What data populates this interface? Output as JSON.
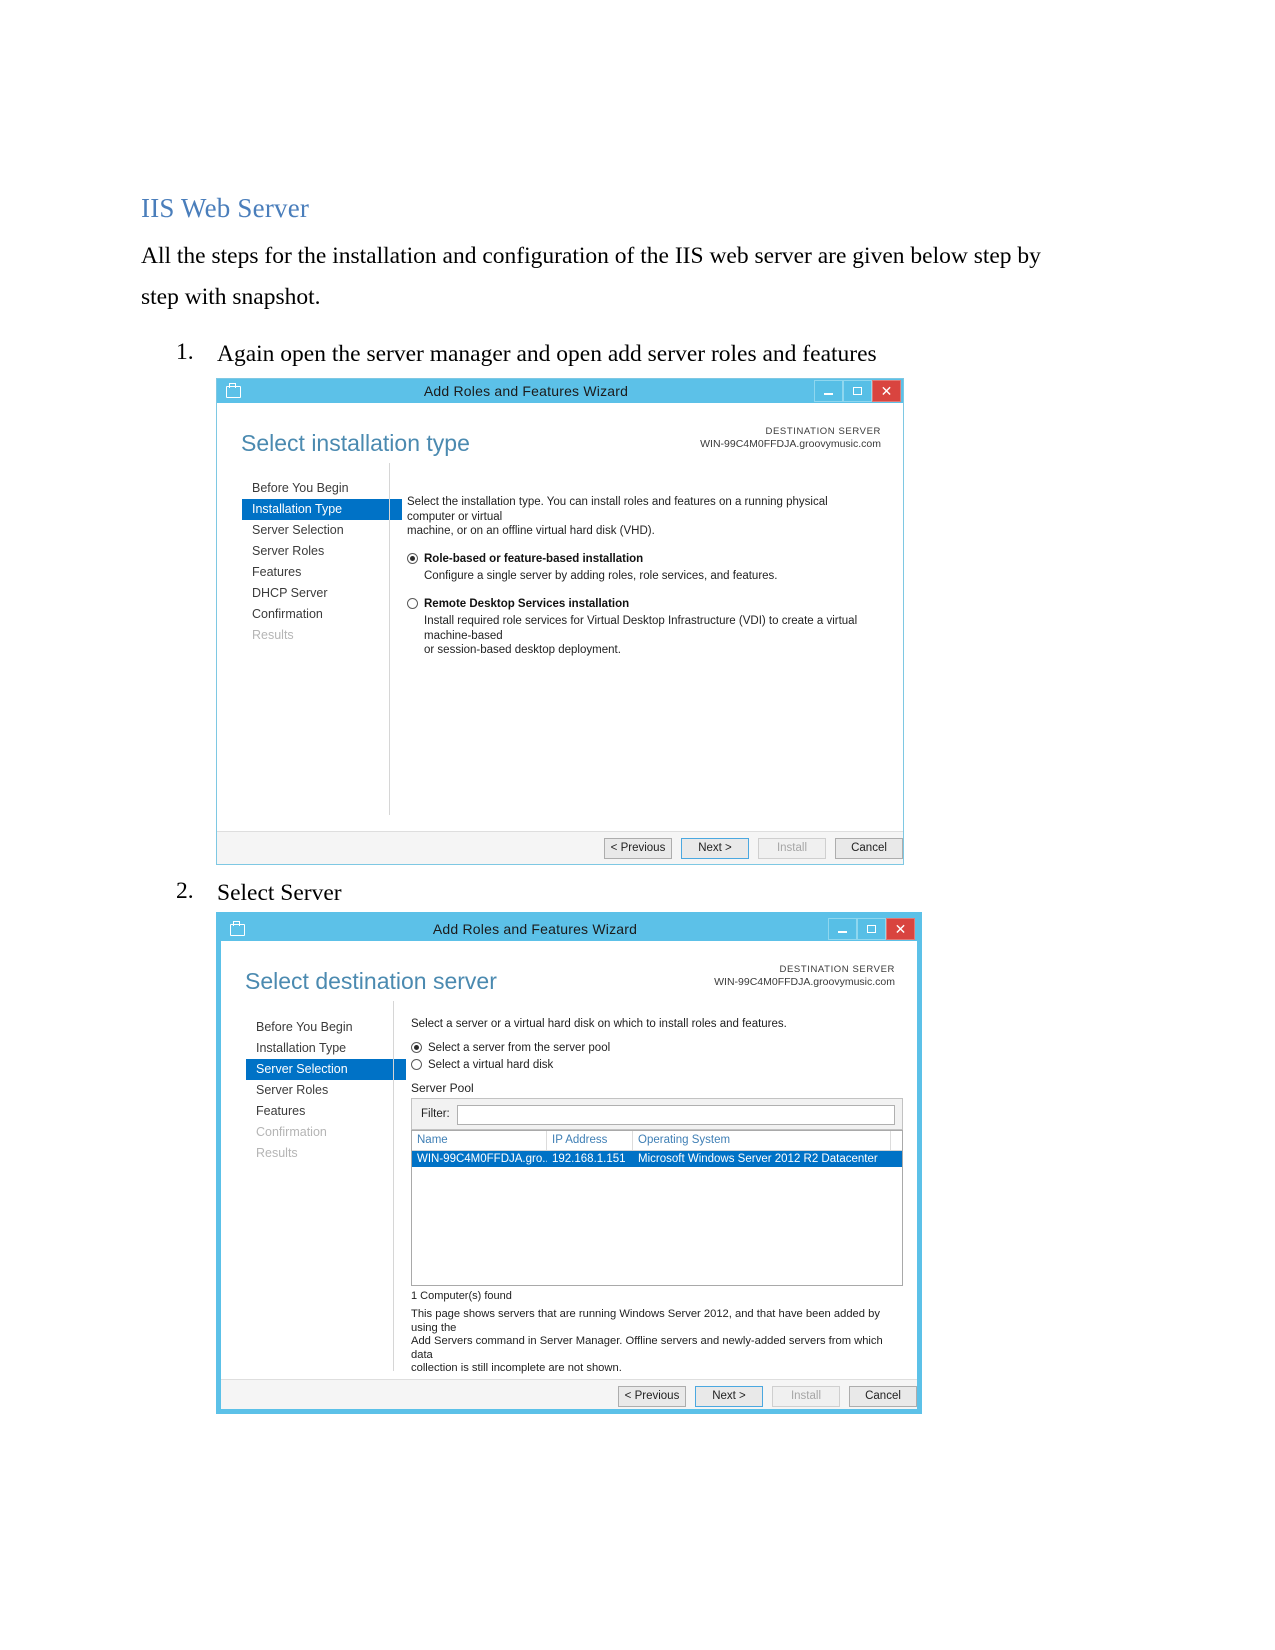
{
  "document": {
    "heading": "IIS Web Server",
    "paragraph": "All the steps for the installation and configuration of the IIS web server are given below step by step with snapshot.",
    "steps": [
      {
        "number": "1.",
        "text": "Again open the server manager and open add server roles and features"
      },
      {
        "number": "2.",
        "text": "Select Server"
      }
    ]
  },
  "wizard1": {
    "title": "Add Roles and Features Wizard",
    "window_controls": {
      "minimize": "–",
      "maximize": "□",
      "close": "✕"
    },
    "page_title": "Select installation type",
    "destination_label": "DESTINATION SERVER",
    "destination_server": "WIN-99C4M0FFDJA.groovymusic.com",
    "nav": [
      {
        "label": "Before You Begin",
        "state": "normal"
      },
      {
        "label": "Installation Type",
        "state": "selected"
      },
      {
        "label": "Server Selection",
        "state": "normal"
      },
      {
        "label": "Server Roles",
        "state": "normal"
      },
      {
        "label": "Features",
        "state": "normal"
      },
      {
        "label": "DHCP Server",
        "state": "normal"
      },
      {
        "label": "Confirmation",
        "state": "normal"
      },
      {
        "label": "Results",
        "state": "disabled"
      }
    ],
    "intro_line1": "Select the installation type. You can install roles and features on a running physical computer or virtual",
    "intro_line2": "machine, or on an offline virtual hard disk (VHD).",
    "option1_label": "Role-based or feature-based installation",
    "option1_desc": "Configure a single server by adding roles, role services, and features.",
    "option2_label": "Remote Desktop Services installation",
    "option2_desc_line1": "Install required role services for Virtual Desktop Infrastructure (VDI) to create a virtual machine-based",
    "option2_desc_line2": "or session-based desktop deployment.",
    "buttons": {
      "previous": "< Previous",
      "next": "Next >",
      "install": "Install",
      "cancel": "Cancel"
    }
  },
  "wizard2": {
    "title": "Add Roles and Features Wizard",
    "window_controls": {
      "minimize": "–",
      "maximize": "□",
      "close": "✕"
    },
    "page_title": "Select destination server",
    "destination_label": "DESTINATION SERVER",
    "destination_server": "WIN-99C4M0FFDJA.groovymusic.com",
    "nav": [
      {
        "label": "Before You Begin",
        "state": "normal"
      },
      {
        "label": "Installation Type",
        "state": "normal"
      },
      {
        "label": "Server Selection",
        "state": "selected"
      },
      {
        "label": "Server Roles",
        "state": "normal"
      },
      {
        "label": "Features",
        "state": "normal"
      },
      {
        "label": "Confirmation",
        "state": "disabled"
      },
      {
        "label": "Results",
        "state": "disabled"
      }
    ],
    "intro_line1": "Select a server or a virtual hard disk on which to install roles and features.",
    "option1_label": "Select a server from the server pool",
    "option2_label": "Select a virtual hard disk",
    "server_pool_label": "Server Pool",
    "filter_label": "Filter:",
    "filter_value": "",
    "filter_placeholder": "",
    "columns": [
      "Name",
      "IP Address",
      "Operating System"
    ],
    "rows": [
      [
        "WIN-99C4M0FFDJA.gro...",
        "192.168.1.151",
        "Microsoft Windows Server 2012 R2 Datacenter"
      ]
    ],
    "found_note": "1 Computer(s) found",
    "description_line1": "This page shows servers that are running Windows Server 2012, and that have been added by using the",
    "description_line2": "Add Servers command in Server Manager. Offline servers and newly-added servers from which data",
    "description_line3": "collection is still incomplete are not shown.",
    "buttons": {
      "previous": "< Previous",
      "next": "Next >",
      "install": "Install",
      "cancel": "Cancel"
    }
  },
  "colors": {
    "heading": "#4a7ebb",
    "titlebar": "#5cc1e8",
    "accent_selected": "#0072c6",
    "close_button": "#d9443f",
    "page_title": "#4b8ab0"
  }
}
